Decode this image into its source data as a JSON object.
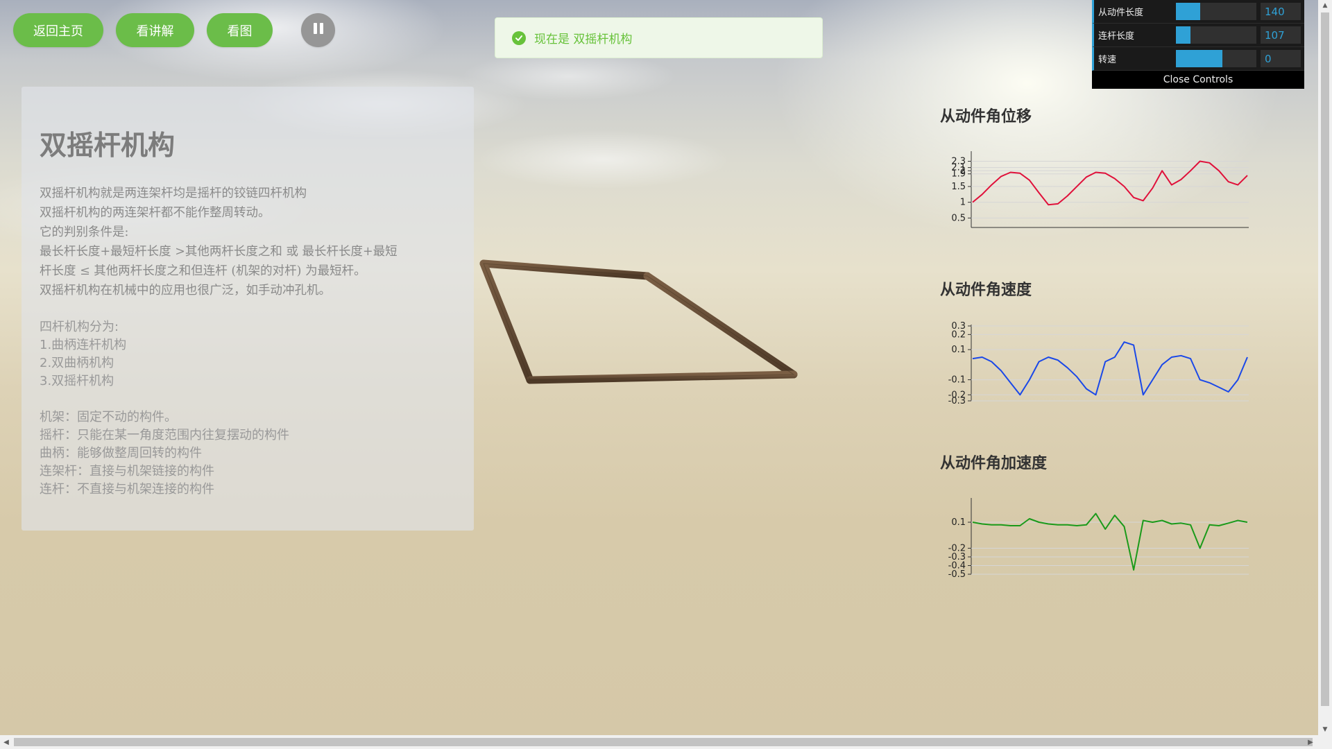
{
  "toolbar": {
    "home_label": "返回主页",
    "lecture_label": "看讲解",
    "view_label": "看图",
    "pause_icon": "pause-icon"
  },
  "notice": {
    "text": "现在是 双摇杆机构",
    "icon": "check-circle-icon",
    "color": "#67c23a"
  },
  "info": {
    "title": "双摇杆机构",
    "description": [
      "双摇杆机构就是两连架杆均是摇杆的铰链四杆机构",
      "双摇杆机构的两连架杆都不能作整周转动。",
      "它的判别条件是:",
      "最长杆长度+最短杆长度 >其他两杆长度之和 或 最长杆长度+最短",
      "杆长度 ≤ 其他两杆长度之和但连杆 (机架的对杆) 为最短杆。",
      "双摇杆机构在机械中的应用也很广泛，如手动冲孔机。"
    ],
    "types_heading": "四杆机构分为:",
    "types": [
      "1.曲柄连杆机构",
      "2.双曲柄机构",
      "3.双摇杆机构"
    ],
    "terms": [
      "机架：固定不动的构件。",
      "摇杆：只能在某一角度范围内往复摆动的构件",
      "曲柄：能够做整周回转的构件",
      "连架杆：直接与机架链接的构件",
      "连杆：不直接与机架连接的构件"
    ]
  },
  "controls": {
    "accent": "#2fa1d6",
    "rows": [
      {
        "label": "从动件长度",
        "value": "140",
        "fraction": 0.3
      },
      {
        "label": "连杆长度",
        "value": "107",
        "fraction": 0.18
      },
      {
        "label": "转速",
        "value": "0",
        "fraction": 0.58
      }
    ],
    "close_label": "Close Controls"
  },
  "chart_data": [
    {
      "type": "line",
      "title": "从动件角位移",
      "color": "#e0103a",
      "y_ticks": [
        "2.3",
        "2.1",
        "1.9",
        "1.5",
        "2",
        "1",
        "0.5"
      ],
      "ylim": [
        0.2,
        2.4
      ],
      "values": [
        1.0,
        1.25,
        1.55,
        1.82,
        1.95,
        1.92,
        1.7,
        1.3,
        0.92,
        0.95,
        1.2,
        1.5,
        1.8,
        1.95,
        1.92,
        1.75,
        1.5,
        1.15,
        1.05,
        1.45,
        2.0,
        1.55,
        1.72,
        2.0,
        2.3,
        2.25,
        2.0,
        1.65,
        1.55,
        1.85
      ]
    },
    {
      "type": "line",
      "title": "从动件角速度",
      "color": "#1a48e8",
      "y_ticks": [
        "0.3",
        "0.2",
        "0.1",
        "-0.1",
        "-0.2",
        "-0.3"
      ],
      "ylim": [
        -0.24,
        0.22
      ],
      "values": [
        0.04,
        0.05,
        0.02,
        -0.04,
        -0.12,
        -0.2,
        -0.1,
        0.02,
        0.05,
        0.03,
        -0.02,
        -0.08,
        -0.16,
        -0.2,
        0.02,
        0.05,
        0.15,
        0.13,
        -0.2,
        -0.1,
        0.0,
        0.05,
        0.06,
        0.04,
        -0.1,
        -0.12,
        -0.15,
        -0.18,
        -0.1,
        0.05
      ]
    },
    {
      "type": "line",
      "title": "从动件角加速度",
      "color": "#1a9a1a",
      "y_ticks": [
        "0.1",
        "-0.2",
        "-0.3",
        "-0.4",
        "-0.5"
      ],
      "ylim": [
        -0.5,
        0.3
      ],
      "values": [
        0.1,
        0.08,
        0.07,
        0.07,
        0.06,
        0.06,
        0.14,
        0.1,
        0.08,
        0.07,
        0.07,
        0.06,
        0.07,
        0.2,
        0.02,
        0.18,
        0.05,
        -0.45,
        0.12,
        0.1,
        0.12,
        0.08,
        0.09,
        0.07,
        -0.2,
        0.07,
        0.06,
        0.09,
        0.12,
        0.1
      ]
    }
  ]
}
